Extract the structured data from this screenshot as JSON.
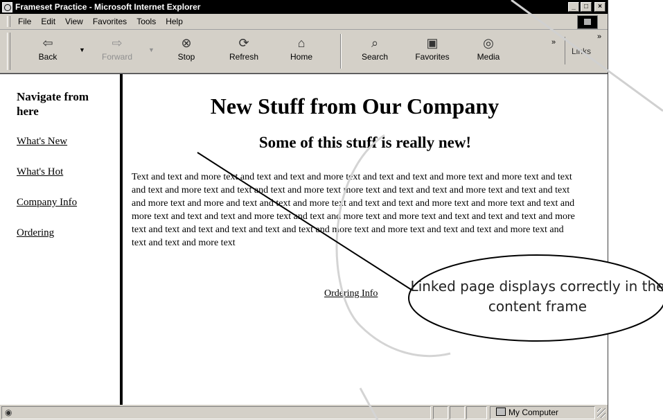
{
  "window": {
    "title": "Frameset Practice - Microsoft Internet Explorer"
  },
  "menu": [
    "File",
    "Edit",
    "View",
    "Favorites",
    "Tools",
    "Help"
  ],
  "toolbar": {
    "buttons": [
      {
        "label": "Back",
        "icon": "back-arrow-icon"
      },
      {
        "label": "Forward",
        "icon": "forward-arrow-icon"
      },
      {
        "label": "Stop",
        "icon": "stop-icon"
      },
      {
        "label": "Refresh",
        "icon": "refresh-icon"
      },
      {
        "label": "Home",
        "icon": "home-icon"
      },
      {
        "label": "Search",
        "icon": "search-icon"
      },
      {
        "label": "Favorites",
        "icon": "favorites-icon"
      },
      {
        "label": "Media",
        "icon": "media-icon"
      }
    ],
    "links_label": "Links"
  },
  "nav_frame": {
    "heading": "Navigate from here",
    "links": [
      "What's New",
      "What's Hot",
      "Company Info",
      "Ordering"
    ]
  },
  "content_frame": {
    "title": "New Stuff from Our Company",
    "subtitle": "Some of this stuff is really new!",
    "paragraph": "Text and text and more text and text and text and more text and text and text and more text and more text and text and text and more text and text and text and more text more text and text and text and more text and text and text and more text and more and text and text and more text and text and text and more text and more text and text and more text and text and text and more text and text and more text and more text and text and text and text and more text and text and text and text and text and text and more text and more text and text and text and more text and text and text and more text",
    "link": "Ordering Info"
  },
  "status": {
    "zone": "My Computer"
  },
  "callout": {
    "text": "Linked page displays correctly in the content frame"
  }
}
